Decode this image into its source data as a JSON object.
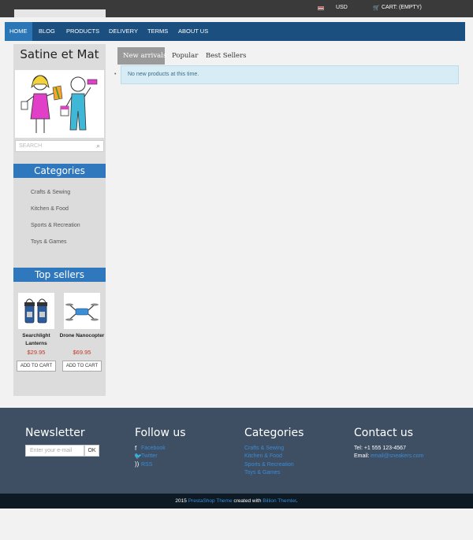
{
  "topbar": {
    "currency": "USD",
    "cart": "CART: (EMPTY)"
  },
  "nav": {
    "items": [
      "HOME",
      "BLOG",
      "PRODUCTS",
      "DELIVERY",
      "TERMS",
      "ABOUT US"
    ]
  },
  "sidebar": {
    "site_name": "Satine et Mat",
    "search_placeholder": "SEARCH",
    "categories_title": "Categories",
    "categories": [
      "Crafts & Sewing",
      "Kitchen & Food",
      "Sports & Recreation",
      "Toys & Games"
    ],
    "top_sellers_title": "Top sellers",
    "products": [
      {
        "name": "Searchlight Lanterns",
        "price": "$29.95",
        "button": "ADD TO CART"
      },
      {
        "name": "Drone Nanocopter",
        "price": "$69.95",
        "button": "ADD TO CART"
      }
    ]
  },
  "main": {
    "tabs": [
      "New arrivals",
      "Popular",
      "Best Sellers"
    ],
    "alert": "No new products at this time."
  },
  "footer": {
    "newsletter": {
      "title": "Newsletter",
      "placeholder": "Enter your e-mail",
      "button": "OK"
    },
    "follow": {
      "title": "Follow us",
      "links": [
        "Facebook",
        "Twitter",
        "RSS"
      ]
    },
    "categories": {
      "title": "Categories",
      "links": [
        "Crafts & Sewing",
        "Kitchen & Food",
        "Sports & Recreation",
        "Toys & Games"
      ]
    },
    "contact": {
      "title": "Contact us",
      "tel": "Tel: +1 555 123-4567",
      "email_label": "Email:",
      "email": "email@sneakers.com"
    }
  },
  "bottom": {
    "year": "2015",
    "theme_link": "PrestaShop Theme",
    "created": "created with",
    "maker_link": "Billion Themler",
    "end": "."
  }
}
